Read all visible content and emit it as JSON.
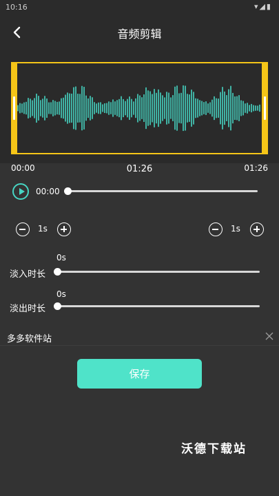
{
  "status": {
    "time": "10:16",
    "icons": "▾◢▮"
  },
  "header": {
    "title": "音频剪辑"
  },
  "timeline": {
    "start": "00:00",
    "middle": "01:26",
    "end": "01:26"
  },
  "player": {
    "position": "00:00",
    "progress": 0
  },
  "trim": {
    "left_step": "1s",
    "right_step": "1s"
  },
  "fade_in": {
    "label": "淡入时长",
    "value": "0s",
    "level": 0
  },
  "fade_out": {
    "label": "淡出时长",
    "value": "0s",
    "level": 0
  },
  "ad": {
    "text": "多多软件站"
  },
  "save": {
    "label": "保存"
  },
  "watermark": {
    "text": "沃德下载站"
  },
  "colors": {
    "accent": "#47d6c4",
    "save_button": "#4fe3c9",
    "trim_handle": "#f5c518",
    "background": "#333333"
  }
}
